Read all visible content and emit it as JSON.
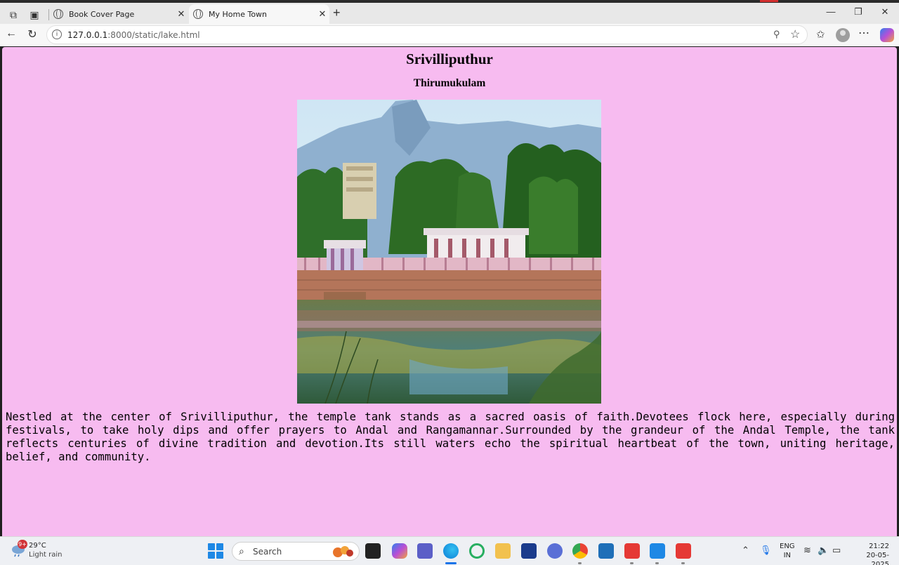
{
  "browser": {
    "tabs": [
      {
        "label": "Book Cover Page",
        "active": false
      },
      {
        "label": "My Home Town",
        "active": true
      }
    ],
    "url_host": "127.0.0.1",
    "url_path": ":8000/static/lake.html"
  },
  "page": {
    "title": "Srivilliputhur",
    "subtitle": "Thirumukulam",
    "paragraph": "Nestled at the center of Srivilliputhur, the temple tank stands as a sacred oasis of faith.Devotees flock here, especially during festivals, to take holy dips and offer prayers to Andal and Rangamannar.Surrounded by the grandeur of the Andal Temple, the tank reflects centuries of divine tradition and devotion.Its still waters echo the spiritual heartbeat of the town, uniting heritage, belief, and community.",
    "background_color": "#f7bbf0"
  },
  "taskbar": {
    "weather_badge": "9+",
    "weather_temp": "29°C",
    "weather_desc": "Light rain",
    "search_placeholder": "Search",
    "lang_top": "ENG",
    "lang_bottom": "IN",
    "time": "21:22",
    "date": "20-05-2025"
  }
}
